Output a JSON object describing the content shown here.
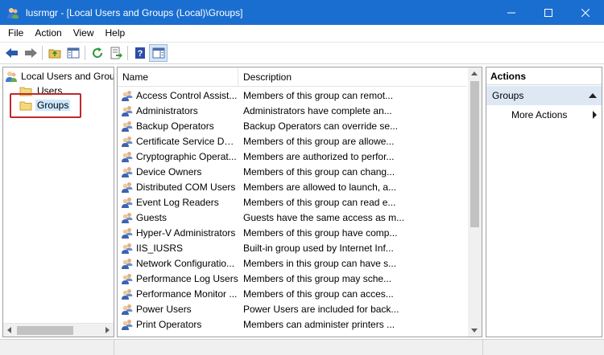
{
  "window": {
    "title": "lusrmgr - [Local Users and Groups (Local)\\Groups]",
    "accent": "#1a6ed0",
    "buttons": [
      "minimize-icon",
      "maximize-icon",
      "close-icon"
    ]
  },
  "menu": {
    "items": [
      {
        "label": "File"
      },
      {
        "label": "Action"
      },
      {
        "label": "View"
      },
      {
        "label": "Help"
      }
    ]
  },
  "toolbar": {
    "icons": [
      "back-arrow-icon",
      "forward-arrow-icon",
      "up-folder-icon",
      "show-hide-tree-icon",
      "refresh-icon",
      "export-list-icon",
      "help-icon",
      "show-hide-action-pane-icon"
    ]
  },
  "tree": {
    "root_label": "Local Users and Grou",
    "users_label": "Users",
    "groups_label": "Groups",
    "selected": "Groups",
    "highlight_color": "#c0282a"
  },
  "list": {
    "columns": {
      "name": "Name",
      "description": "Description"
    },
    "rows": [
      {
        "name": "Access Control Assist...",
        "description": "Members of this group can remot..."
      },
      {
        "name": "Administrators",
        "description": "Administrators have complete an..."
      },
      {
        "name": "Backup Operators",
        "description": "Backup Operators can override se..."
      },
      {
        "name": "Certificate Service DC...",
        "description": "Members of this group are allowe..."
      },
      {
        "name": "Cryptographic Operat...",
        "description": "Members are authorized to perfor..."
      },
      {
        "name": "Device Owners",
        "description": "Members of this group can chang..."
      },
      {
        "name": "Distributed COM Users",
        "description": "Members are allowed to launch, a..."
      },
      {
        "name": "Event Log Readers",
        "description": "Members of this group can read e..."
      },
      {
        "name": "Guests",
        "description": "Guests have the same access as m..."
      },
      {
        "name": "Hyper-V Administrators",
        "description": "Members of this group have comp..."
      },
      {
        "name": "IIS_IUSRS",
        "description": "Built-in group used by Internet Inf..."
      },
      {
        "name": "Network Configuratio...",
        "description": "Members in this group can have s..."
      },
      {
        "name": "Performance Log Users",
        "description": "Members of this group may sche..."
      },
      {
        "name": "Performance Monitor ...",
        "description": "Members of this group can acces..."
      },
      {
        "name": "Power Users",
        "description": "Power Users are included for back..."
      },
      {
        "name": "Print Operators",
        "description": "Members can administer printers ..."
      }
    ]
  },
  "actions": {
    "header": "Actions",
    "section": "Groups",
    "more": "More Actions",
    "section_color": "#dde8f4"
  }
}
